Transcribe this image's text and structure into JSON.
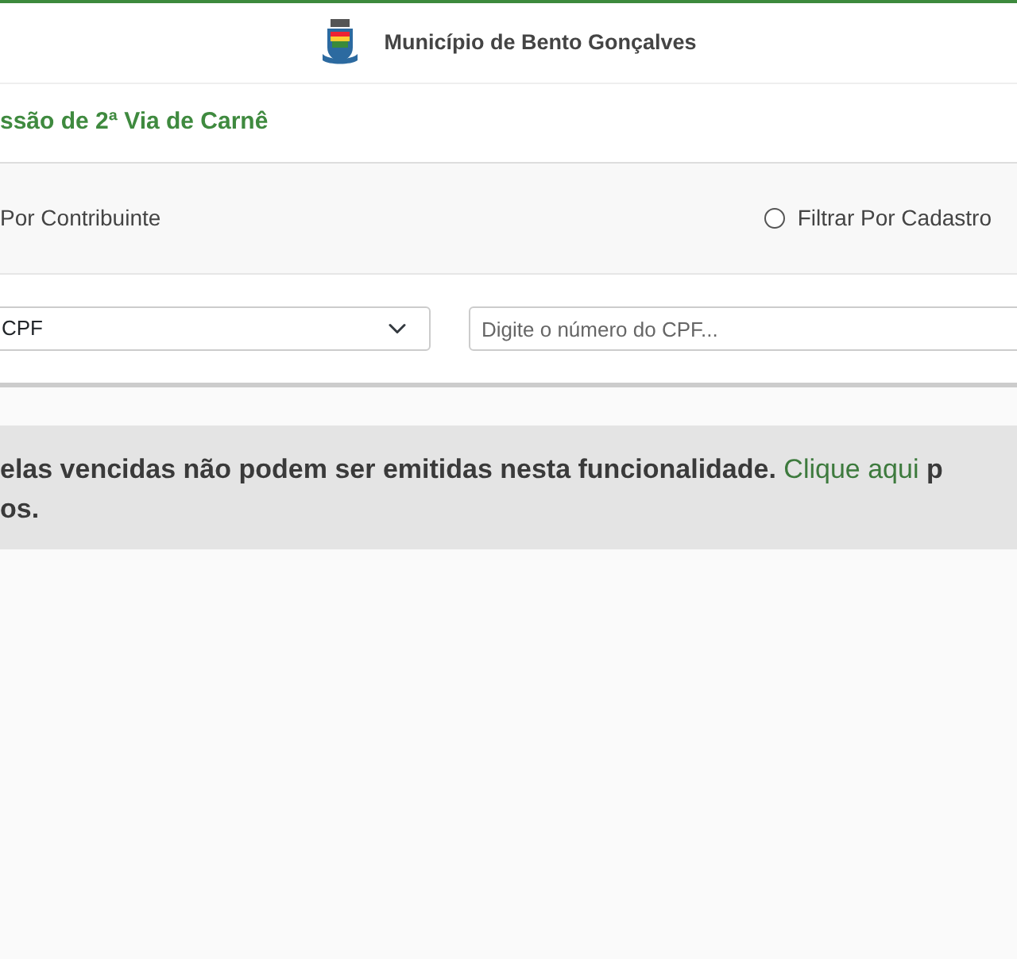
{
  "header": {
    "title": "Município de Bento Gonçalves"
  },
  "page_title": "ssão de 2ª Via de Carnê",
  "filters": [
    {
      "label": "Por Contribuinte",
      "kind": "cut"
    },
    {
      "label": "Filtrar Por Cadastro",
      "kind": "radio",
      "selected": false
    }
  ],
  "search": {
    "type_value": "CPF",
    "placeholder": "Digite o número do CPF..."
  },
  "notice": {
    "text": "elas vencidas não podem ser emitidas nesta funcionalidade.",
    "link": "Clique aqui",
    "text_after": "p",
    "line_2": "os."
  }
}
